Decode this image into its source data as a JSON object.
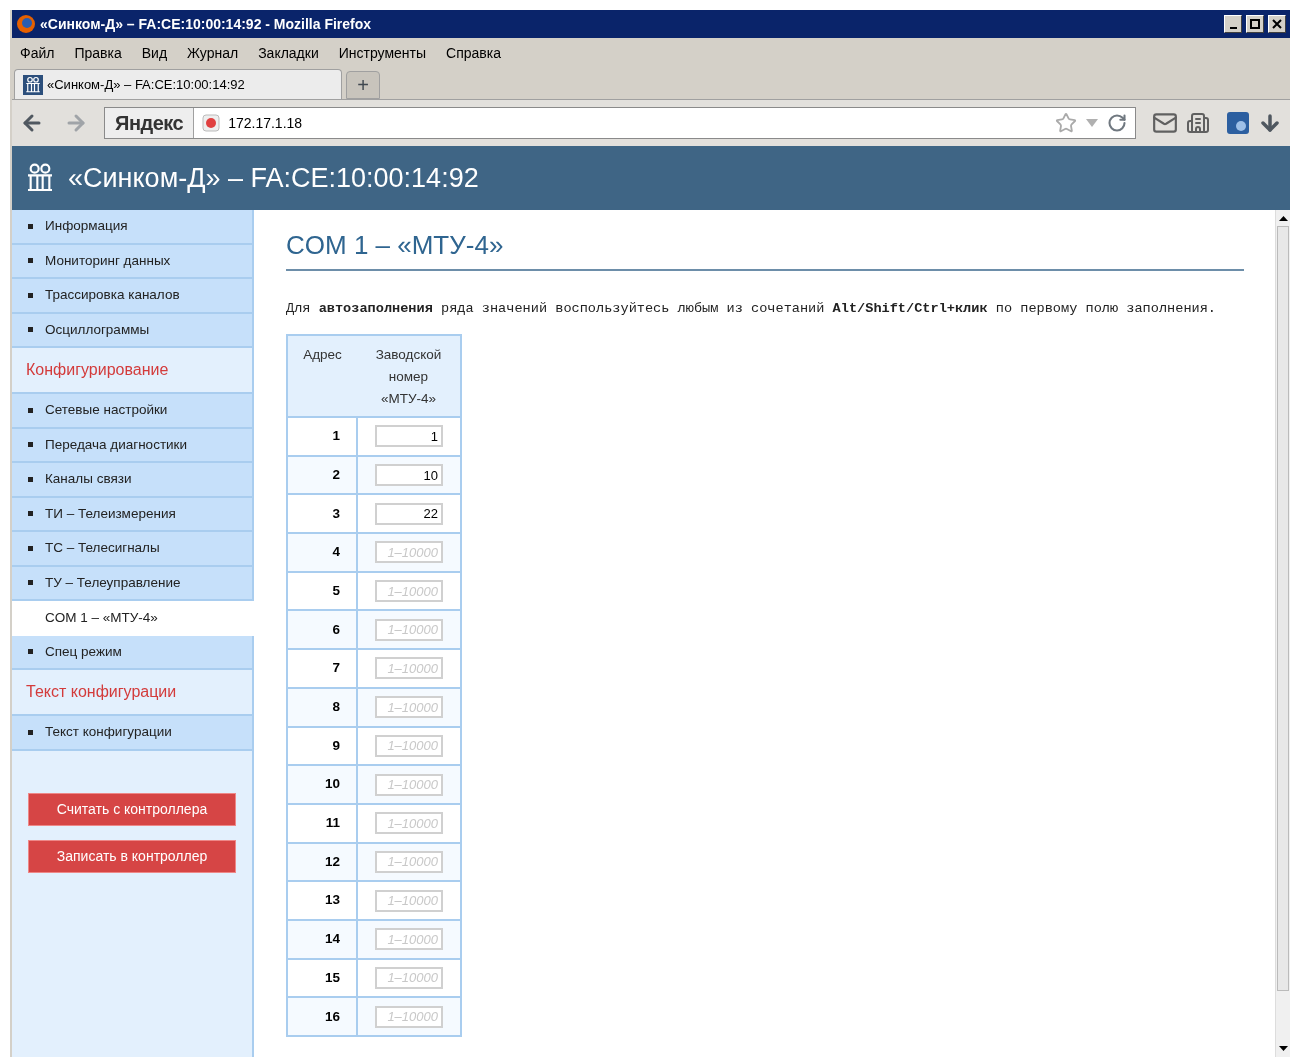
{
  "window": {
    "title": "«Синком-Д» – FA:CE:10:00:14:92 - Mozilla Firefox"
  },
  "menu": [
    "Файл",
    "Правка",
    "Вид",
    "Журнал",
    "Закладки",
    "Инструменты",
    "Справка"
  ],
  "tabs": [
    {
      "label": "«Синком-Д» – FA:CE:10:00:14:92",
      "selected": true
    }
  ],
  "new_tab": "+",
  "search_engine": "Яндекс",
  "address": "172.17.1.18",
  "header": {
    "title": "«Синком-Д» – FA:CE:10:00:14:92"
  },
  "sidebar": {
    "items": [
      {
        "kind": "link",
        "label": "Информация",
        "selected": false
      },
      {
        "kind": "link",
        "label": "Мониторинг данных",
        "selected": false
      },
      {
        "kind": "link",
        "label": "Трассировка каналов",
        "selected": false
      },
      {
        "kind": "link",
        "label": "Осциллограммы",
        "selected": false
      },
      {
        "kind": "heading",
        "label": "Конфигурирование"
      },
      {
        "kind": "link",
        "label": "Сетевые настройки",
        "selected": false
      },
      {
        "kind": "link",
        "label": "Передача диагностики",
        "selected": false
      },
      {
        "kind": "link",
        "label": "Каналы связи",
        "selected": false
      },
      {
        "kind": "link",
        "label": "ТИ – Телеизмерения",
        "selected": false
      },
      {
        "kind": "link",
        "label": "ТС – Телесигналы",
        "selected": false
      },
      {
        "kind": "link",
        "label": "ТУ – Телеуправление",
        "selected": false
      },
      {
        "kind": "link",
        "label": "COM 1 – «МТУ-4»",
        "selected": true
      },
      {
        "kind": "link",
        "label": "Спец режим",
        "selected": false
      },
      {
        "kind": "heading",
        "label": "Текст конфигурации"
      },
      {
        "kind": "link",
        "label": "Текст конфигурации",
        "selected": false
      }
    ],
    "buttons": [
      "Считать с контроллера",
      "Записать в контроллер"
    ]
  },
  "content": {
    "title": "COM 1 – «МТУ-4»",
    "hint": "Для **автозаполнения** ряда значений воспользуйтесь любым из сочетаний **Alt/Shift/Ctrl+клик** по первому полю заполнения.",
    "table": {
      "columns": [
        "Адрес",
        "Заводской номер «МТУ-4»"
      ],
      "rows": [
        {
          "address": "1",
          "value": "1"
        },
        {
          "address": "2",
          "value": "10"
        },
        {
          "address": "3",
          "value": "22"
        },
        {
          "address": "4",
          "placeholder": "1–10000"
        },
        {
          "address": "5",
          "placeholder": "1–10000"
        },
        {
          "address": "6",
          "placeholder": "1–10000"
        },
        {
          "address": "7",
          "placeholder": "1–10000"
        },
        {
          "address": "8",
          "placeholder": "1–10000"
        },
        {
          "address": "9",
          "placeholder": "1–10000"
        },
        {
          "address": "10",
          "placeholder": "1–10000"
        },
        {
          "address": "11",
          "placeholder": "1–10000"
        },
        {
          "address": "12",
          "placeholder": "1–10000"
        },
        {
          "address": "13",
          "placeholder": "1–10000"
        },
        {
          "address": "14",
          "placeholder": "1–10000"
        },
        {
          "address": "15",
          "placeholder": "1–10000"
        },
        {
          "address": "16",
          "placeholder": "1–10000"
        }
      ]
    }
  }
}
